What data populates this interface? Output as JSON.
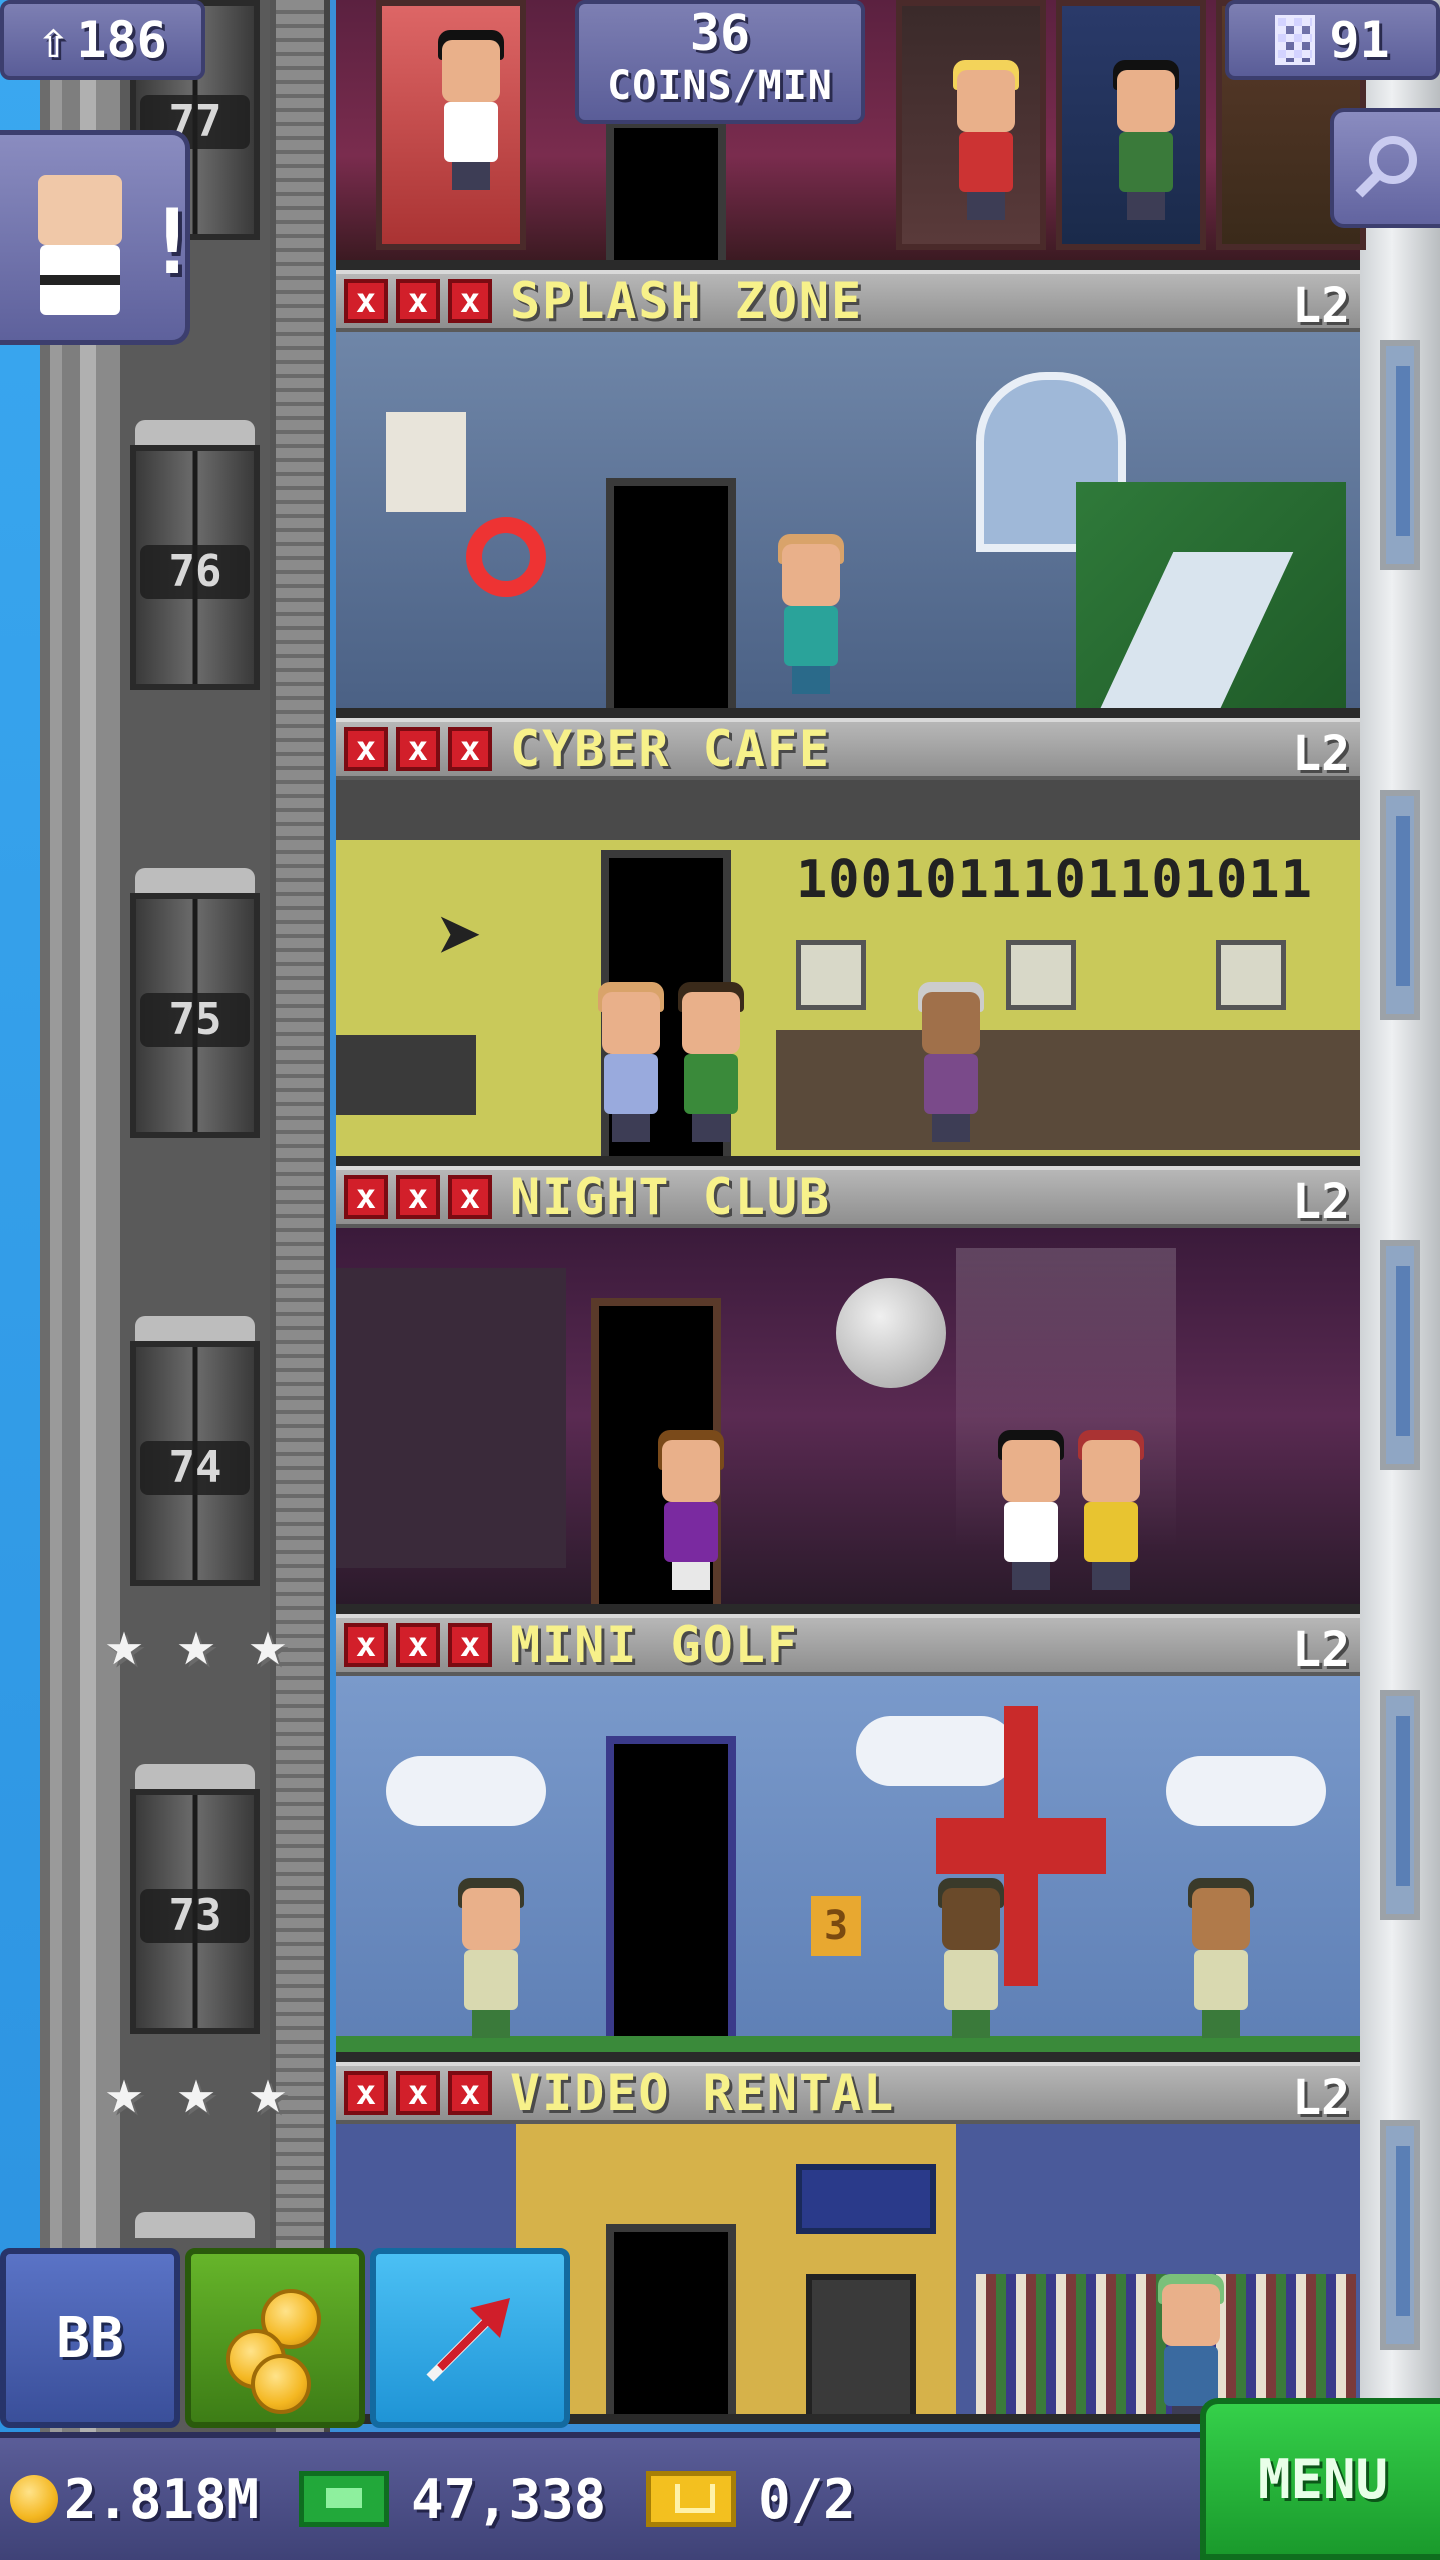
{
  "hud": {
    "population": "186",
    "coin_rate_value": "36",
    "coin_rate_label": "COINS/MIN",
    "floor_count": "91"
  },
  "elevator_numbers": [
    "77",
    "76",
    "75",
    "74",
    "73"
  ],
  "floors": [
    {
      "name": "SPLASH ZONE",
      "level": "L2",
      "stock": [
        "x",
        "x",
        "x"
      ]
    },
    {
      "name": "CYBER CAFE",
      "level": "L2",
      "stock": [
        "x",
        "x",
        "x"
      ],
      "wall_text": "1001011101101011"
    },
    {
      "name": "NIGHT CLUB",
      "level": "L2",
      "stock": [
        "x",
        "x",
        "x"
      ]
    },
    {
      "name": "MINI GOLF",
      "level": "L2",
      "stock": [
        "x",
        "x",
        "x"
      ],
      "sign": "3"
    },
    {
      "name": "VIDEO RENTAL",
      "level": "L2",
      "stock": [
        "x",
        "x",
        "x"
      ]
    }
  ],
  "toolbar": {
    "bb_label": "BB",
    "coins_icon": "coins-icon",
    "raise_icon": "arrow-up-right-icon"
  },
  "status": {
    "coins": "2.818M",
    "bux": "47,338",
    "tickets": "0/2"
  },
  "menu_label": "MENU",
  "colors": {
    "floor_name": "#f7f18a",
    "stock_red": "#d21f2a",
    "hud_purple": "#5a5d98",
    "menu_green": "#1a9a2c"
  }
}
